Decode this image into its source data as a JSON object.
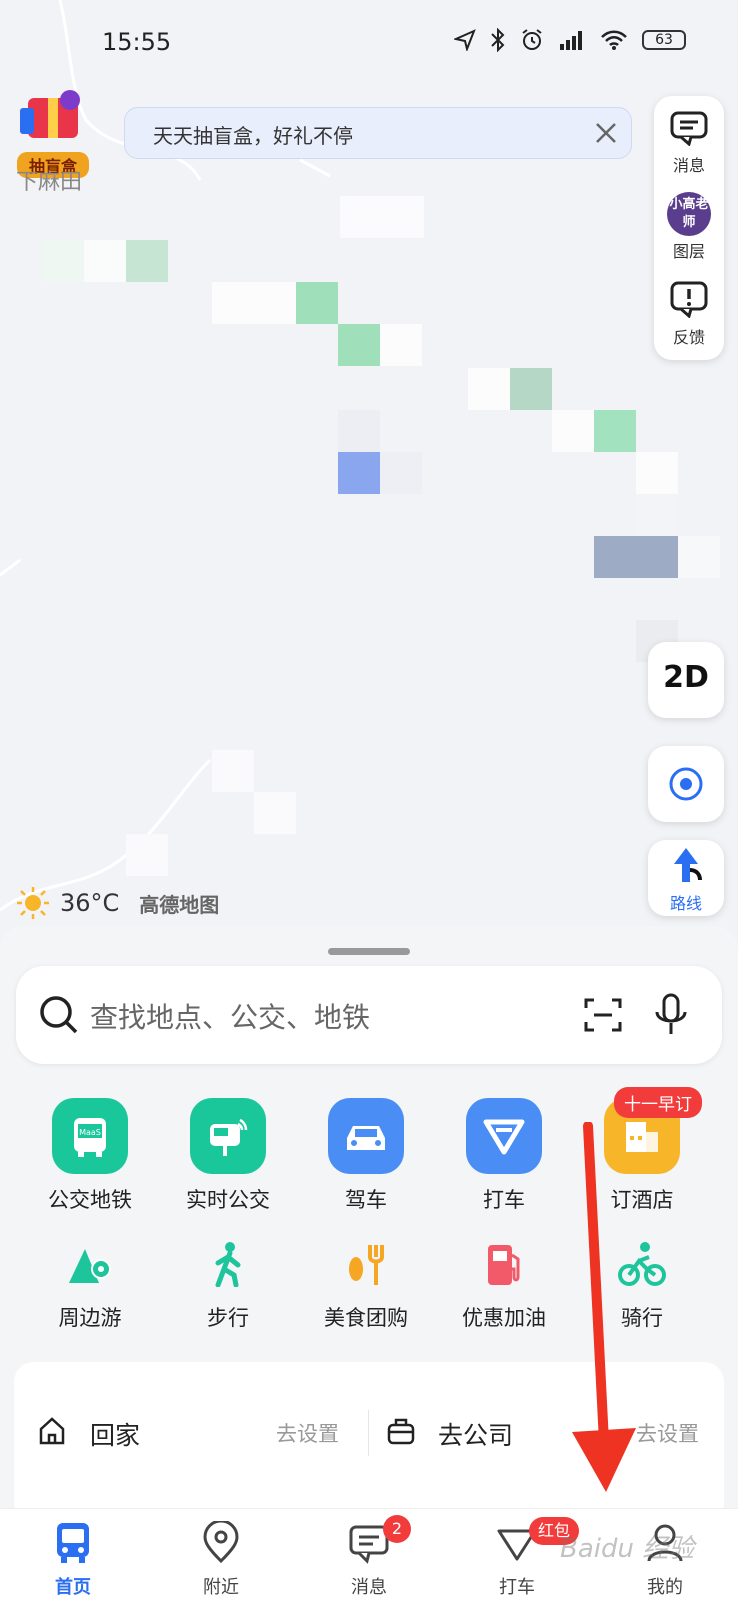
{
  "status_bar": {
    "time": "15:55",
    "battery": "63"
  },
  "map": {
    "place_label": "下麻田",
    "blind_box_label": "抽盲盒",
    "banner_text": "天天抽盲盒，好礼不停",
    "side_panel": [
      {
        "label": "消息"
      },
      {
        "label": "图层",
        "avatar_text": "小高老师"
      },
      {
        "label": "反馈"
      }
    ],
    "btn_2d": "2D",
    "btn_route": "路线",
    "weather": {
      "temp": "36°C",
      "brand": "高德地图"
    }
  },
  "search": {
    "placeholder": "查找地点、公交、地铁"
  },
  "grid_row1": [
    {
      "label": "公交地铁",
      "icon": "bus-maas-icon",
      "color": "#19c79a",
      "icon_text": "MaaS"
    },
    {
      "label": "实时公交",
      "icon": "realtime-bus-icon",
      "color": "#19c79a"
    },
    {
      "label": "驾车",
      "icon": "car-icon",
      "color": "#4a8ef5"
    },
    {
      "label": "打车",
      "icon": "taxi-icon",
      "color": "#4a8ef5"
    },
    {
      "label": "订酒店",
      "icon": "hotel-icon",
      "color": "#f7b52a",
      "badge": "十一早订"
    }
  ],
  "grid_row2": [
    {
      "label": "周边游",
      "icon": "travel-icon",
      "color": "#1ec49b"
    },
    {
      "label": "步行",
      "icon": "walk-icon",
      "color": "#1ec49b"
    },
    {
      "label": "美食团购",
      "icon": "food-icon",
      "color": "#f5a623"
    },
    {
      "label": "优惠加油",
      "icon": "fuel-icon",
      "color": "#f25a6a"
    },
    {
      "label": "骑行",
      "icon": "bike-icon",
      "color": "#1ec49b"
    }
  ],
  "quick": {
    "home_label": "回家",
    "home_action": "去设置",
    "work_label": "去公司",
    "work_action": "去设置"
  },
  "tabs": [
    {
      "label": "首页",
      "active": true
    },
    {
      "label": "附近"
    },
    {
      "label": "消息",
      "badge": "2"
    },
    {
      "label": "打车",
      "badge": "红包"
    },
    {
      "label": "我的"
    }
  ],
  "watermark": "Baidu 经验",
  "colors": {
    "accent": "#2a6ef2",
    "arrow": "#ee3322"
  }
}
